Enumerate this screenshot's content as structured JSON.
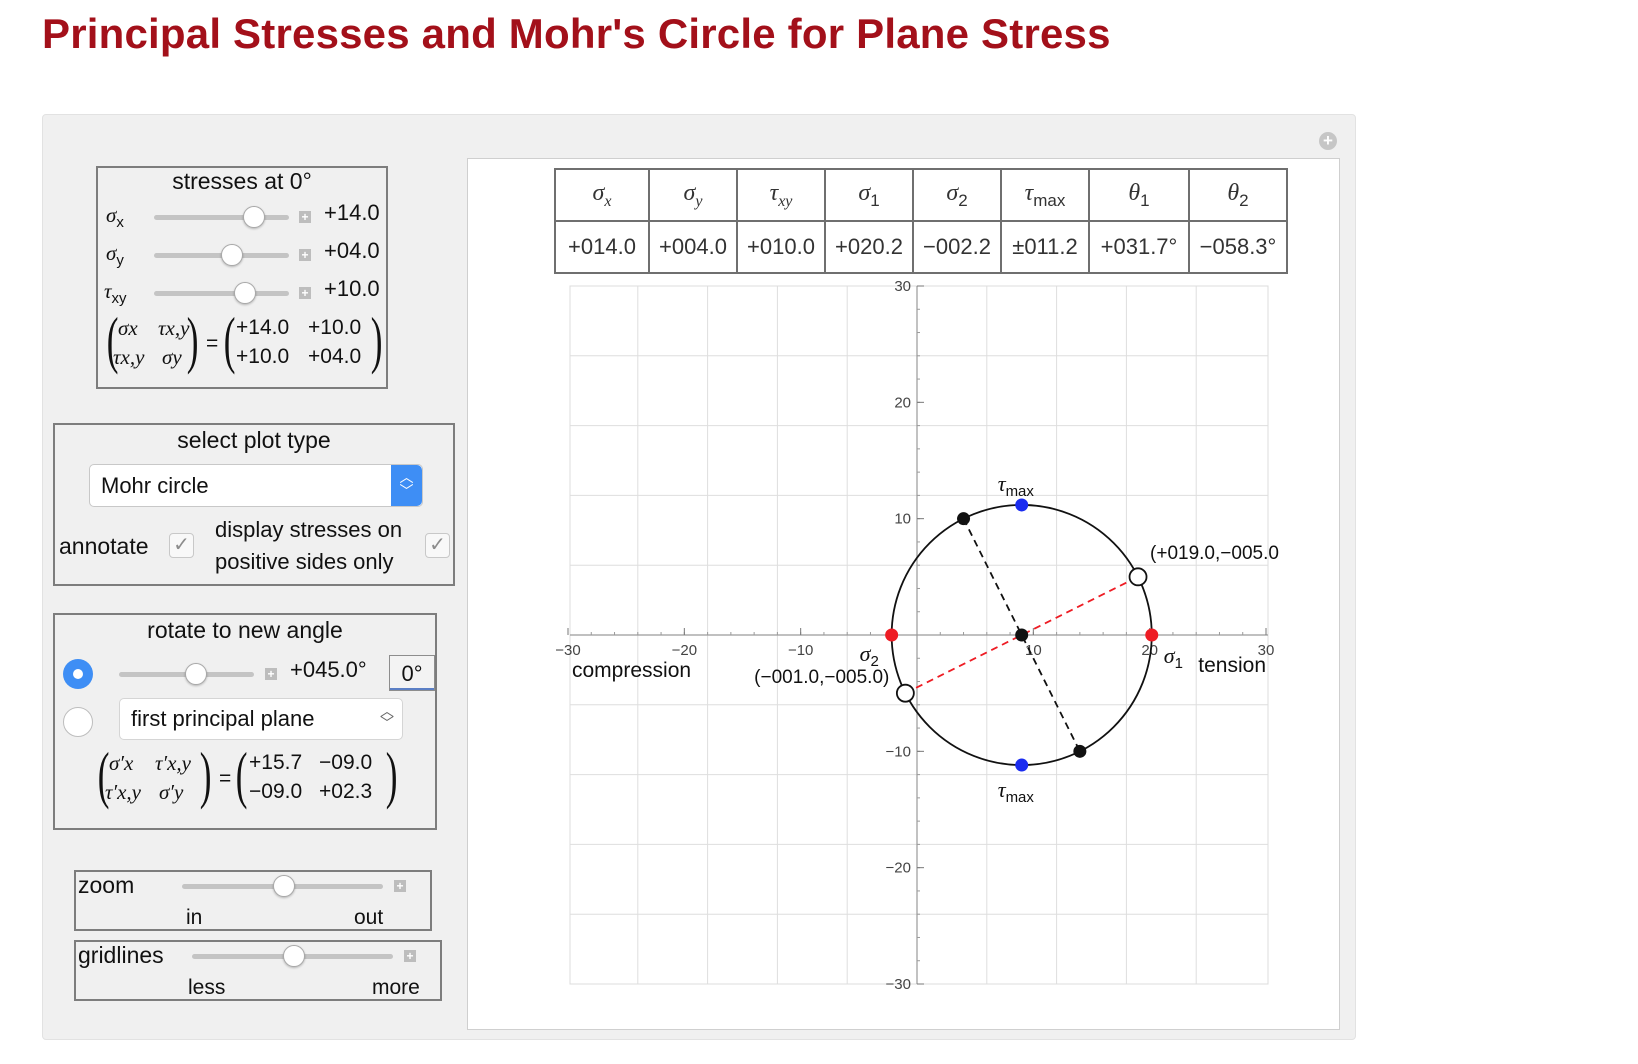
{
  "page_title": "Principal Stresses and Mohr's Circle for Plane Stress",
  "stresses": {
    "title": "stresses at 0°",
    "sigma_x": {
      "symbol": "σ",
      "sub": "x",
      "value": "+14.0",
      "level": 0.73
    },
    "sigma_y": {
      "symbol": "σ",
      "sub": "y",
      "value": "+04.0",
      "level": 0.57
    },
    "tau_xy": {
      "symbol": "τ",
      "sub": "xy",
      "value": "+10.0",
      "level": 0.67
    },
    "matrix_symbols": [
      "σx",
      "τx,y",
      "τx,y",
      "σy"
    ],
    "matrix_values": [
      "+14.0",
      "+10.0",
      "+10.0",
      "+04.0"
    ]
  },
  "plot_type": {
    "title": "select plot type",
    "selected": "Mohr circle",
    "annotate_label": "annotate",
    "annotate_checked": true,
    "positive_sides_label_1": "display stresses on",
    "positive_sides_label_2": "positive sides only",
    "positive_sides_checked": true,
    "check_mark": "✓"
  },
  "rotate": {
    "title": "rotate to new angle",
    "angle_value": "+045.0°",
    "angle_level": 0.56,
    "reset_button": "0°",
    "plane_select": "first principal plane",
    "selected_option": "angle",
    "matrix_symbols": [
      "σ′x",
      "τ′x,y",
      "τ′x,y",
      "σ′y"
    ],
    "matrix_values": [
      "+15.7",
      "−09.0",
      "−09.0",
      "+02.3"
    ]
  },
  "zoom": {
    "label": "zoom",
    "min_label": "in",
    "max_label": "out",
    "level": 0.5
  },
  "gridlines": {
    "label": "gridlines",
    "min_label": "less",
    "max_label": "more",
    "level": 0.5
  },
  "results_table": {
    "headers": [
      {
        "sym": "σ",
        "sub": "x"
      },
      {
        "sym": "σ",
        "sub": "y"
      },
      {
        "sym": "τ",
        "sub": "xy"
      },
      {
        "sym": "σ",
        "sub": "1"
      },
      {
        "sym": "σ",
        "sub": "2"
      },
      {
        "sym": "τ",
        "sub": "max"
      },
      {
        "sym": "θ",
        "sub": "1"
      },
      {
        "sym": "θ",
        "sub": "2"
      }
    ],
    "values": [
      "+014.0",
      "+004.0",
      "+010.0",
      "+020.2",
      "−002.2",
      "±011.2",
      "+031.7°",
      "−058.3°"
    ]
  },
  "chart_data": {
    "type": "scatter",
    "xlim": [
      -30,
      30
    ],
    "ylim": [
      -30,
      30
    ],
    "x_ticks": [
      -30,
      -20,
      -10,
      10,
      20,
      30
    ],
    "x_tick_labels": [
      "−30",
      "−20",
      "−10",
      "10",
      "20",
      "30"
    ],
    "y_ticks": [
      30,
      20,
      10,
      -10,
      -20,
      -30
    ],
    "y_tick_labels": [
      "30",
      "20",
      "10",
      "−10",
      "−20",
      "−30"
    ],
    "grid": true,
    "circle": {
      "center": [
        9.0,
        0
      ],
      "radius": 11.18
    },
    "center_point": [
      9.0,
      0
    ],
    "principal_points": [
      [
        -2.18,
        0
      ],
      [
        20.18,
        0
      ]
    ],
    "tau_max_points": [
      [
        9.0,
        11.18
      ],
      [
        9.0,
        -11.18
      ]
    ],
    "original_diameter": [
      [
        4.0,
        10.0
      ],
      [
        14.0,
        -10.0
      ]
    ],
    "rotated_diameter": [
      [
        -1.0,
        -5.0
      ],
      [
        19.0,
        5.0
      ]
    ],
    "colors": {
      "principal": "#ee1c24",
      "tau": "#1a2cf0",
      "rotated": "#ee1c24",
      "original": "#111111"
    },
    "labels": {
      "sigma2": "σ2",
      "sigma1": "σ1",
      "tau_top": "τmax",
      "tau_bottom": "τmax",
      "compression": "compression",
      "tension": "tension",
      "point_left": "(−001.0,−005.0)",
      "point_right": "(+019.0,−005.0"
    }
  }
}
